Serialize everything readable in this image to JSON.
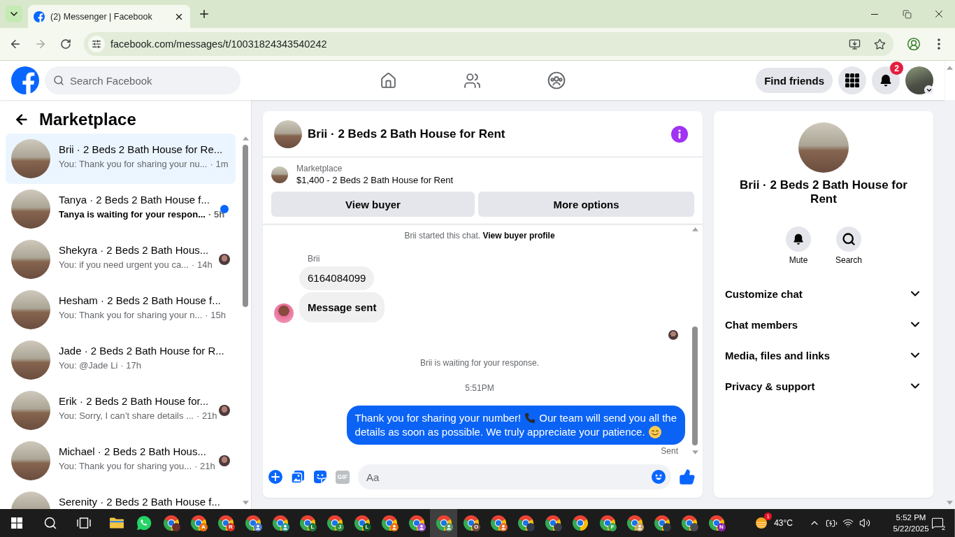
{
  "browser": {
    "tab": {
      "title": "(2) Messenger | Facebook"
    },
    "address": {
      "url": "facebook.com/messages/t/10031824343540242"
    }
  },
  "header": {
    "search": {
      "placeholder": "Search Facebook"
    },
    "nav": [
      {
        "kind": "home"
      },
      {
        "kind": "friends"
      },
      {
        "kind": "groups"
      }
    ],
    "find_friends": "Find friends",
    "notification_count": "2"
  },
  "sidebar": {
    "title": "Marketplace",
    "conversations": [
      {
        "title": "Brii · 2 Beds 2 Bath House for Re...",
        "preview": "You: Thank you for sharing your nu...",
        "time": "· 1m",
        "selected": true,
        "unread": false,
        "seen": false
      },
      {
        "title": "Tanya · 2 Beds 2 Bath House f...",
        "preview": "Tanya is waiting for your respon...",
        "time": "· 5h",
        "selected": false,
        "unread": true,
        "seen": false
      },
      {
        "title": "Shekyra · 2 Beds 2 Bath Hous...",
        "preview": "You: if you need urgent you ca...",
        "time": "· 14h",
        "selected": false,
        "unread": false,
        "seen": true
      },
      {
        "title": "Hesham · 2 Beds 2 Bath House f...",
        "preview": "You: Thank you for sharing your n...",
        "time": "· 15h",
        "selected": false,
        "unread": false,
        "seen": false
      },
      {
        "title": "Jade · 2 Beds 2 Bath House for R...",
        "preview": "You: @Jade Li",
        "time": "· 17h",
        "selected": false,
        "unread": false,
        "seen": false
      },
      {
        "title": "Erik · 2 Beds 2 Bath House for...",
        "preview": "You: Sorry, I can’t share details ...",
        "time": "· 21h",
        "selected": false,
        "unread": false,
        "seen": true
      },
      {
        "title": "Michael · 2 Beds 2 Bath Hous...",
        "preview": "You: Thank you for sharing you...",
        "time": "· 21h",
        "selected": false,
        "unread": false,
        "seen": true
      },
      {
        "title": "Serenity · 2 Beds 2 Bath House f...",
        "selected": false,
        "unread": false,
        "seen": false
      }
    ]
  },
  "chat": {
    "title": "Brii · 2 Beds 2 Bath House for Rent",
    "listing": {
      "source": "Marketplace",
      "title": "$1,400 - 2 Beds 2 Bath House for Rent"
    },
    "actions": [
      "View buyer",
      "More options"
    ],
    "messages": [
      {
        "kind": "notice",
        "text": "Brii started this chat.",
        "link": "View buyer profile"
      },
      {
        "kind": "sender",
        "text": "Brii"
      },
      {
        "kind": "incoming",
        "text": "6164084099",
        "bold": false,
        "avatar": false
      },
      {
        "kind": "incoming",
        "text": "Message sent",
        "bold": true,
        "avatar": true
      },
      {
        "kind": "seen"
      },
      {
        "kind": "status",
        "text": "Brii is waiting for your response."
      },
      {
        "kind": "time",
        "text": "5:51PM"
      },
      {
        "kind": "outgoing",
        "lines": [
          [
            {
              "kind": "text",
              "text": "Thank you for sharing your number!"
            },
            {
              "kind": "phone"
            },
            {
              "kind": "text",
              "text": "Our team will send you all the"
            }
          ],
          [
            {
              "kind": "text",
              "text": "details as soon as possible. We truly appreciate your patience."
            },
            {
              "kind": "smile"
            }
          ]
        ]
      },
      {
        "kind": "delivery",
        "text": "Sent"
      }
    ],
    "tools": [
      {
        "kind": "plus",
        "disabled": false
      },
      {
        "kind": "photo",
        "disabled": false
      },
      {
        "kind": "sticker",
        "disabled": false
      },
      {
        "kind": "gif",
        "label": "GIF",
        "disabled": true
      }
    ],
    "composer": {
      "placeholder": "Aa"
    }
  },
  "details": {
    "title": "Brii · 2 Beds 2 Bath House for Rent",
    "actions": [
      {
        "kind": "mute",
        "label": "Mute"
      },
      {
        "kind": "search",
        "label": "Search"
      }
    ],
    "sections": [
      {
        "label": "Customize chat",
        "expanded": false
      },
      {
        "label": "Chat members",
        "expanded": false
      },
      {
        "label": "Media, files and links",
        "expanded": false
      },
      {
        "label": "Privacy & support",
        "expanded": false
      }
    ]
  },
  "taskbar": {
    "system": [
      {
        "kind": "start"
      },
      {
        "kind": "search"
      },
      {
        "kind": "task-view"
      }
    ],
    "apps": [
      {
        "kind": "explorer",
        "active": false
      },
      {
        "kind": "whatsapp",
        "active": false
      },
      {
        "kind": "chrome",
        "badge": {
          "kind": "photo",
          "color": "#6b2d2d"
        },
        "active": false
      },
      {
        "kind": "chrome",
        "badge": {
          "kind": "letter",
          "letter": "A",
          "color": "#e8710a"
        },
        "active": false
      },
      {
        "kind": "chrome",
        "badge": {
          "kind": "letter",
          "letter": "R",
          "color": "#d93025"
        },
        "active": false
      },
      {
        "kind": "chrome",
        "badge": {
          "kind": "person",
          "color": "#4a7fd4"
        },
        "active": false
      },
      {
        "kind": "chrome",
        "badge": {
          "kind": "person",
          "color": "#2e9e8c"
        },
        "active": false
      },
      {
        "kind": "chrome",
        "badge": {
          "kind": "letter",
          "letter": "L",
          "color": "#1e7a3c"
        },
        "active": false
      },
      {
        "kind": "chrome",
        "badge": {
          "kind": "letter",
          "letter": "J",
          "color": "#2e8b3e"
        },
        "active": false
      },
      {
        "kind": "chrome",
        "badge": {
          "kind": "letter",
          "letter": "L",
          "color": "#0f5a2a"
        },
        "active": false
      },
      {
        "kind": "chrome",
        "badge": {
          "kind": "person",
          "color": "#e8710a"
        },
        "active": false
      },
      {
        "kind": "chrome",
        "badge": {
          "kind": "person",
          "color": "#9b59d0"
        },
        "active": false
      },
      {
        "kind": "chrome",
        "badge": {
          "kind": "person",
          "color": "#5a9a6a"
        },
        "active": true
      },
      {
        "kind": "chrome",
        "badge": {
          "kind": "letter",
          "letter": "O",
          "color": "#6d4c41"
        },
        "active": false
      },
      {
        "kind": "chrome",
        "badge": {
          "kind": "person",
          "color": "#e36b2c"
        },
        "active": false
      },
      {
        "kind": "chrome",
        "badge": {
          "kind": "photo",
          "color": "#2f3a4a"
        },
        "active": false
      },
      {
        "kind": "chrome",
        "badge": {
          "kind": "photo",
          "color": "#3a3f4a"
        },
        "active": false
      },
      {
        "kind": "chrome",
        "active": false
      },
      {
        "kind": "chrome",
        "badge": {
          "kind": "letter",
          "letter": "F",
          "color": "#34a853"
        },
        "active": false
      },
      {
        "kind": "chrome",
        "badge": {
          "kind": "person",
          "color": "#c9a46b"
        },
        "active": false
      },
      {
        "kind": "chrome",
        "badge": {
          "kind": "photo",
          "color": "#333a44"
        },
        "active": false
      },
      {
        "kind": "chrome",
        "badge": {
          "kind": "photo",
          "color": "#4a4a52"
        },
        "active": false
      },
      {
        "kind": "chrome",
        "badge": {
          "kind": "letter",
          "letter": "N",
          "color": "#8e24aa"
        },
        "active": false
      }
    ],
    "weather": {
      "temperature": "43°C",
      "alert_count": "1"
    },
    "clock": {
      "time": "5:52 PM",
      "date": "5/22/2025"
    },
    "notification_count": "2"
  }
}
